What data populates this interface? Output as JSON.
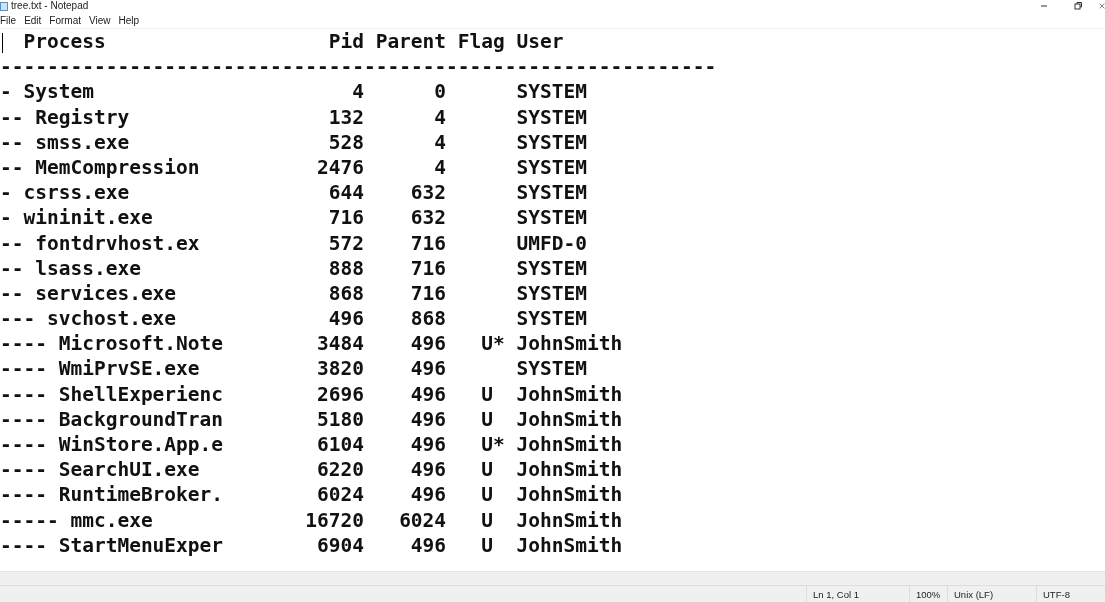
{
  "window": {
    "title": "tree.txt - Notepad"
  },
  "menu": [
    "File",
    "Edit",
    "Format",
    "View",
    "Help"
  ],
  "header": {
    "process": "Process",
    "pid": "Pid",
    "parent": "Parent",
    "flag": "Flag",
    "user": "User"
  },
  "separator": "-------------------------------------------------------------",
  "rows": [
    {
      "process": "- System",
      "pid": "4",
      "parent": "0",
      "flag": "",
      "user": "SYSTEM"
    },
    {
      "process": "-- Registry",
      "pid": "132",
      "parent": "4",
      "flag": "",
      "user": "SYSTEM"
    },
    {
      "process": "-- smss.exe",
      "pid": "528",
      "parent": "4",
      "flag": "",
      "user": "SYSTEM"
    },
    {
      "process": "-- MemCompression",
      "pid": "2476",
      "parent": "4",
      "flag": "",
      "user": "SYSTEM"
    },
    {
      "process": "- csrss.exe",
      "pid": "644",
      "parent": "632",
      "flag": "",
      "user": "SYSTEM"
    },
    {
      "process": "- wininit.exe",
      "pid": "716",
      "parent": "632",
      "flag": "",
      "user": "SYSTEM"
    },
    {
      "process": "-- fontdrvhost.ex",
      "pid": "572",
      "parent": "716",
      "flag": "",
      "user": "UMFD-0"
    },
    {
      "process": "-- lsass.exe",
      "pid": "888",
      "parent": "716",
      "flag": "",
      "user": "SYSTEM"
    },
    {
      "process": "-- services.exe",
      "pid": "868",
      "parent": "716",
      "flag": "",
      "user": "SYSTEM"
    },
    {
      "process": "--- svchost.exe",
      "pid": "496",
      "parent": "868",
      "flag": "",
      "user": "SYSTEM"
    },
    {
      "process": "---- Microsoft.Note",
      "pid": "3484",
      "parent": "496",
      "flag": "U*",
      "user": "JohnSmith"
    },
    {
      "process": "---- WmiPrvSE.exe",
      "pid": "3820",
      "parent": "496",
      "flag": "",
      "user": "SYSTEM"
    },
    {
      "process": "---- ShellExperienc",
      "pid": "2696",
      "parent": "496",
      "flag": "U",
      "user": "JohnSmith"
    },
    {
      "process": "---- BackgroundTran",
      "pid": "5180",
      "parent": "496",
      "flag": "U",
      "user": "JohnSmith"
    },
    {
      "process": "---- WinStore.App.e",
      "pid": "6104",
      "parent": "496",
      "flag": "U*",
      "user": "JohnSmith"
    },
    {
      "process": "---- SearchUI.exe",
      "pid": "6220",
      "parent": "496",
      "flag": "U",
      "user": "JohnSmith"
    },
    {
      "process": "---- RuntimeBroker.",
      "pid": "6024",
      "parent": "496",
      "flag": "U",
      "user": "JohnSmith"
    },
    {
      "process": "----- mmc.exe",
      "pid": "16720",
      "parent": "6024",
      "flag": "U",
      "user": "JohnSmith"
    },
    {
      "process": "---- StartMenuExper",
      "pid": "6904",
      "parent": "496",
      "flag": "U",
      "user": "JohnSmith"
    }
  ],
  "status_bar": {
    "position": "Ln 1, Col 1",
    "zoom": "100%",
    "line_ending": "Unix (LF)",
    "encoding": "UTF-8"
  }
}
